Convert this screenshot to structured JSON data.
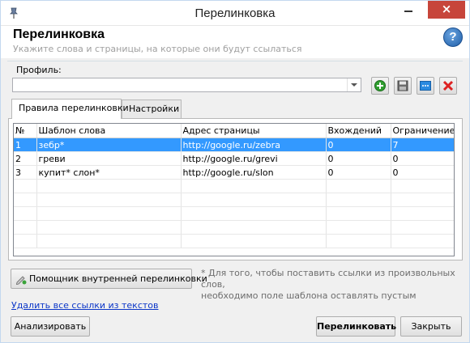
{
  "window": {
    "title": "Перелинковка",
    "close_glyph": "×",
    "icons": {
      "app": "thumbtack-icon",
      "minimize": "minimize-icon",
      "close": "close-icon"
    }
  },
  "header": {
    "title": "Перелинковка",
    "subtitle": "Укажите слова и страницы, на которые они будут ссылаться",
    "help_glyph": "?"
  },
  "profile": {
    "label": "Профиль:",
    "value": "",
    "toolbar_icons": [
      "add-icon",
      "save-icon",
      "more-icon",
      "delete-icon"
    ]
  },
  "tabs": [
    {
      "label": "Правила перелинковки",
      "active": true
    },
    {
      "label": "Настройки",
      "active": false
    }
  ],
  "table": {
    "columns": [
      "№",
      "Шаблон слова",
      "Адрес страницы",
      "Вхождений",
      "Ограничение"
    ],
    "rows": [
      {
        "num": "1",
        "pattern": "зебр*",
        "url": "http://google.ru/zebra",
        "occurrences": "0",
        "limit": "7",
        "selected": true
      },
      {
        "num": "2",
        "pattern": "греви",
        "url": "http://google.ru/grevi",
        "occurrences": "0",
        "limit": "0",
        "selected": false
      },
      {
        "num": "3",
        "pattern": "купит* слон*",
        "url": "http://google.ru/slon",
        "occurrences": "0",
        "limit": "0",
        "selected": false
      }
    ],
    "selected_color": "#3399ff"
  },
  "assistant_button": {
    "label": "Помощник внутренней перелинковки",
    "icon": "pencil-icon"
  },
  "note": {
    "line1": "* Для того, чтобы поставить ссылки из произвольных слов,",
    "line2": "необходимо поле шаблона оставлять пустым"
  },
  "delete_link": "Удалить все ссылки из текстов",
  "buttons": {
    "analyze": "Анализировать",
    "link": "Перелинковать",
    "close": "Закрыть"
  }
}
